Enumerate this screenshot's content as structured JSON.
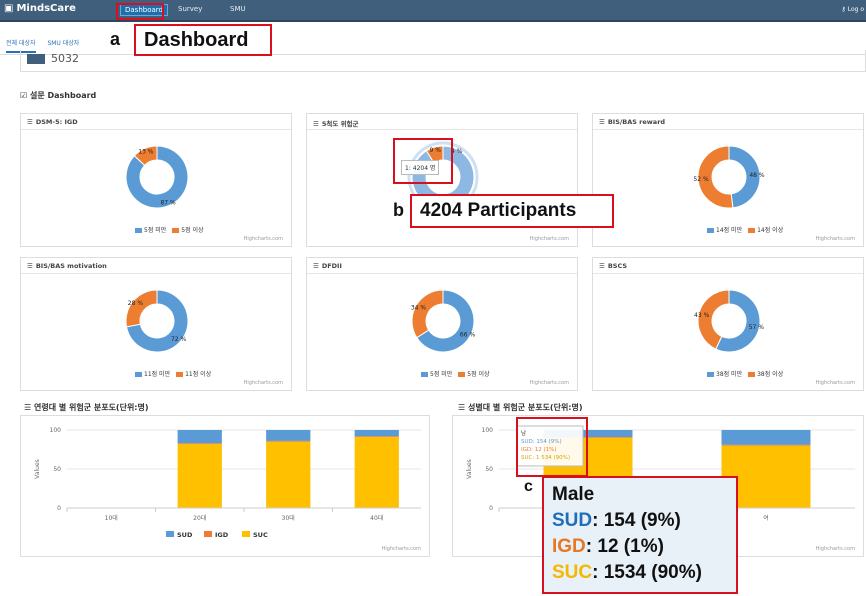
{
  "nav": {
    "brand": "MindsCare",
    "tabs": [
      "Dashboard",
      "Survey",
      "SMU"
    ],
    "logout": "Log o"
  },
  "callouts": {
    "a_letter": "a",
    "a_text": "Dashboard",
    "b_letter": "b",
    "b_text": "4204 Participants",
    "c_letter": "c",
    "c_title": "Male",
    "c_lines": [
      {
        "key": "SUD",
        "rest": ": 154 (9%)",
        "color": "#1f6fb8"
      },
      {
        "key": "IGD",
        "rest": ": 12 (1%)",
        "color": "#e87722"
      },
      {
        "key": "SUC",
        "rest": ": 1534 (90%)",
        "color": "#f5b800"
      }
    ]
  },
  "subtabs": [
    "전체 대상자",
    "SMU 대상자"
  ],
  "count": "5032",
  "section_title": "설문 Dashboard",
  "colors": {
    "blue": "#5b9bd5",
    "orange": "#ed7d31",
    "yellow": "#ffc000",
    "gray": "#999999"
  },
  "donuts": [
    {
      "title": "DSM-5: IGD",
      "labels": [
        "87 %",
        "13 %"
      ],
      "legend": [
        "5점 미만",
        "5점 이상"
      ],
      "values": [
        87,
        13
      ]
    },
    {
      "title": "5척도 위험군",
      "labels": [
        "",
        "9 %"
      ],
      "legend": [],
      "values": [
        91,
        9
      ],
      "tooltip": "1: 4204 명"
    },
    {
      "title": "BIS/BAS reward",
      "labels": [
        "48 %",
        "52 %"
      ],
      "legend": [
        "14점 미만",
        "14점 이상"
      ],
      "values": [
        48,
        52
      ]
    },
    {
      "title": "BIS/BAS motivation",
      "labels": [
        "72 %",
        "28 %"
      ],
      "legend": [
        "11점 미만",
        "11점 이상"
      ],
      "values": [
        72,
        28
      ]
    },
    {
      "title": "DFDII",
      "labels": [
        "66 %",
        "34 %"
      ],
      "legend": [
        "5점 미만",
        "5점 이상"
      ],
      "values": [
        66,
        34
      ]
    },
    {
      "title": "BSCS",
      "labels": [
        "57 %",
        "43 %"
      ],
      "legend": [
        "38점 미만",
        "38점 이상"
      ],
      "values": [
        57,
        43
      ]
    }
  ],
  "donut_extra_label": "4 %",
  "credit": "Highcharts.com",
  "chart_data": [
    {
      "type": "bar",
      "title": "연령대 별 위험군 분포도(단위:명)",
      "ylabel": "Values",
      "ylim": [
        0,
        100
      ],
      "yticks": [
        "0",
        "50",
        "100"
      ],
      "categories": [
        "10대",
        "20대",
        "30대",
        "40대"
      ],
      "series": [
        {
          "name": "SUC",
          "values": [
            0,
            82,
            85,
            91
          ]
        },
        {
          "name": "IGD",
          "values": [
            0,
            1,
            1,
            1
          ]
        },
        {
          "name": "SUD",
          "values": [
            0,
            17,
            14,
            8
          ]
        }
      ],
      "legend": [
        "SUD",
        "IGD",
        "SUC"
      ]
    },
    {
      "type": "bar",
      "title": "성별대 별 위험군 분포도(단위:명)",
      "ylabel": "Values",
      "ylim": [
        0,
        100
      ],
      "yticks": [
        "0",
        "50",
        "100"
      ],
      "categories": [
        "남",
        "여"
      ],
      "series": [
        {
          "name": "SUC",
          "values": [
            90,
            80
          ]
        },
        {
          "name": "IGD",
          "values": [
            1,
            1
          ]
        },
        {
          "name": "SUD",
          "values": [
            9,
            19
          ]
        }
      ],
      "tooltip": {
        "title": "남",
        "lines": [
          "SUD: 154 (9%)",
          "IGD: 12 (1%)",
          "SUC: 1 534 (90%)"
        ]
      }
    }
  ]
}
